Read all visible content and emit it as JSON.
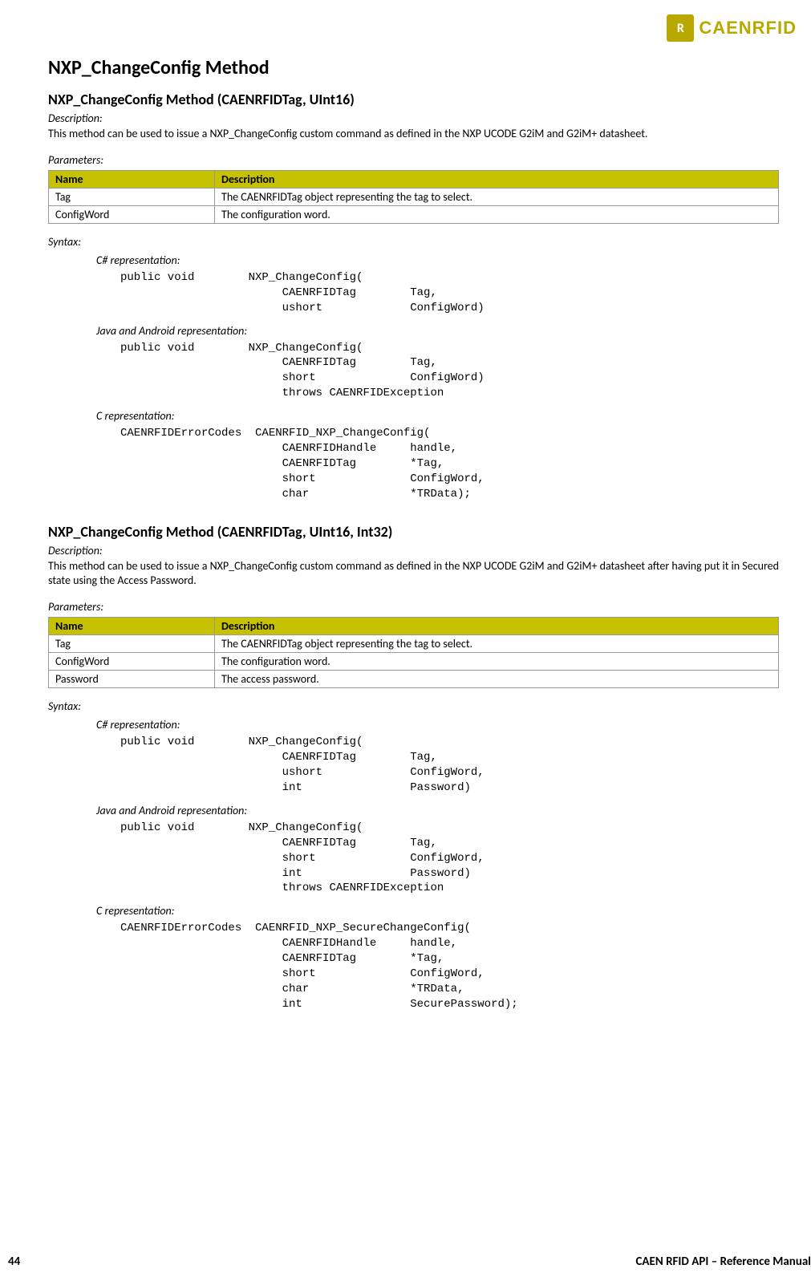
{
  "brand": {
    "mark": "R",
    "name": "CAENRFID"
  },
  "page_title": "NXP_ChangeConfig Method",
  "methods": [
    {
      "heading": "NXP_ChangeConfig Method (CAENRFIDTag, UInt16)",
      "description_label": "Description:",
      "description": "This method can be used to issue a NXP_ChangeConfig custom command as defined in the NXP UCODE G2iM and G2iM+ datasheet.",
      "params_label": "Parameters:",
      "params_headers": {
        "name": "Name",
        "desc": "Description"
      },
      "params": [
        {
          "name": "Tag",
          "desc": "The CAENRFIDTag object representing the tag to select."
        },
        {
          "name": "ConfigWord",
          "desc": "The configuration word."
        }
      ],
      "syntax_label": "Syntax:",
      "reprs": [
        {
          "label": "C# representation:",
          "code": "public void        NXP_ChangeConfig(\n                        CAENRFIDTag        Tag,\n                        ushort             ConfigWord)"
        },
        {
          "label": "Java and Android representation:",
          "code": "public void        NXP_ChangeConfig(\n                        CAENRFIDTag        Tag,\n                        short              ConfigWord)\n                        throws CAENRFIDException"
        },
        {
          "label": "C representation:",
          "code": "CAENRFIDErrorCodes  CAENRFID_NXP_ChangeConfig(\n                        CAENRFIDHandle     handle,\n                        CAENRFIDTag        *Tag,\n                        short              ConfigWord,\n                        char               *TRData);"
        }
      ]
    },
    {
      "heading": "NXP_ChangeConfig Method (CAENRFIDTag, UInt16, Int32)",
      "description_label": "Description:",
      "description": "This method can be used to issue a NXP_ChangeConfig custom command as defined in the NXP UCODE G2iM and G2iM+ datasheet after having put it in Secured state using the Access Password.",
      "params_label": "Parameters:",
      "params_headers": {
        "name": "Name",
        "desc": "Description"
      },
      "params": [
        {
          "name": "Tag",
          "desc": "The CAENRFIDTag object representing the tag to select."
        },
        {
          "name": "ConfigWord",
          "desc": "The configuration word."
        },
        {
          "name": "Password",
          "desc": "The access password."
        }
      ],
      "syntax_label": "Syntax:",
      "reprs": [
        {
          "label": "C# representation:",
          "code": "public void        NXP_ChangeConfig(\n                        CAENRFIDTag        Tag,\n                        ushort             ConfigWord,\n                        int                Password)"
        },
        {
          "label": "Java and Android representation:",
          "code": "public void        NXP_ChangeConfig(\n                        CAENRFIDTag        Tag,\n                        short              ConfigWord,\n                        int                Password)\n                        throws CAENRFIDException"
        },
        {
          "label": "C representation:",
          "code": "CAENRFIDErrorCodes  CAENRFID_NXP_SecureChangeConfig(\n                        CAENRFIDHandle     handle,\n                        CAENRFIDTag        *Tag,\n                        short              ConfigWord,\n                        char               *TRData,\n                        int                SecurePassword);"
        }
      ]
    }
  ],
  "footer": {
    "page_num": "44",
    "doc_title": "CAEN RFID API – Reference Manual"
  }
}
